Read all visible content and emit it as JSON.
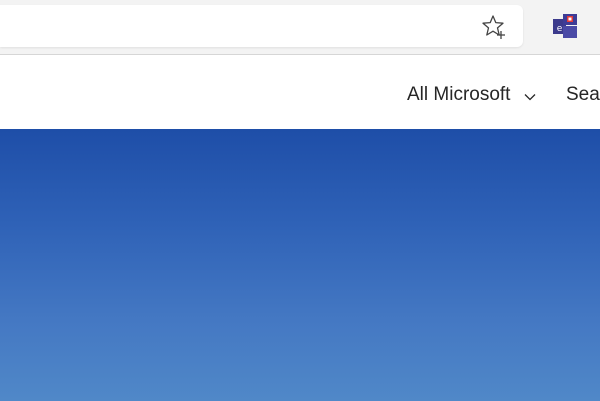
{
  "browser": {
    "address_value": "",
    "favorites_icon": "star-add-icon",
    "extension_icon": "app-extension-icon",
    "extension_colors": {
      "bg": "#3b3a8c",
      "accent": "#e03a3a",
      "letter": "e"
    }
  },
  "header": {
    "menu_label": "All Microsoft",
    "search_label": "Search"
  },
  "hero": {
    "gradient_top": "#1e4ea8",
    "gradient_bottom": "#5088c8"
  }
}
